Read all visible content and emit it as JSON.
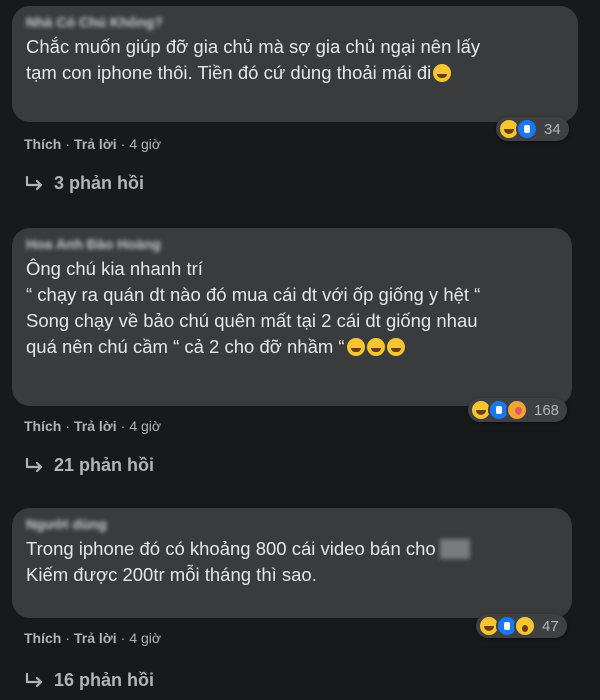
{
  "comments": [
    {
      "author": "Nhà Có Chú Không?",
      "text": "Chắc muốn giúp đỡ gia chủ mà sợ gia chủ ngại nên lấy\ntạm con iphone thôi. Tiền đó cứ dùng thoải mái đi",
      "reaction_count": "34",
      "reaction_icons": [
        "haha-icon",
        "like-icon"
      ],
      "like_label": "Thích",
      "reply_label": "Trả lời",
      "time": "4 giờ",
      "replies_label": "3 phản hồi"
    },
    {
      "author": "Hoa Anh Đào Hoàng",
      "text": "Ông chú kia nhanh trí\n“ chạy ra quán dt nào đó mua cái dt với ốp giống y hệt “\nSong chạy về bảo chú quên mất tại 2 cái dt giống nhau\nquá nên chú cầm “ cả 2 cho đỡ nhầm “",
      "reaction_count": "168",
      "reaction_icons": [
        "haha-icon",
        "like-icon",
        "care-icon"
      ],
      "like_label": "Thích",
      "reply_label": "Trả lời",
      "time": "4 giờ",
      "replies_label": "21 phản hồi"
    },
    {
      "author": "Người dùng",
      "text_line1": "Trong iphone đó có khoảng 800 cái video bán cho",
      "text_line2": "Kiếm được 200tr mỗi tháng thì sao.",
      "reaction_count": "47",
      "reaction_icons": [
        "haha-icon",
        "like-icon",
        "wow-icon"
      ],
      "like_label": "Thích",
      "reply_label": "Trả lời",
      "time": "4 giờ",
      "replies_label": "16 phản hồi"
    }
  ],
  "separator": "·",
  "colors": {
    "background": "#18191a",
    "bubble": "#3a3b3c",
    "text": "#e4e6eb",
    "secondary": "#b0b3b8"
  }
}
